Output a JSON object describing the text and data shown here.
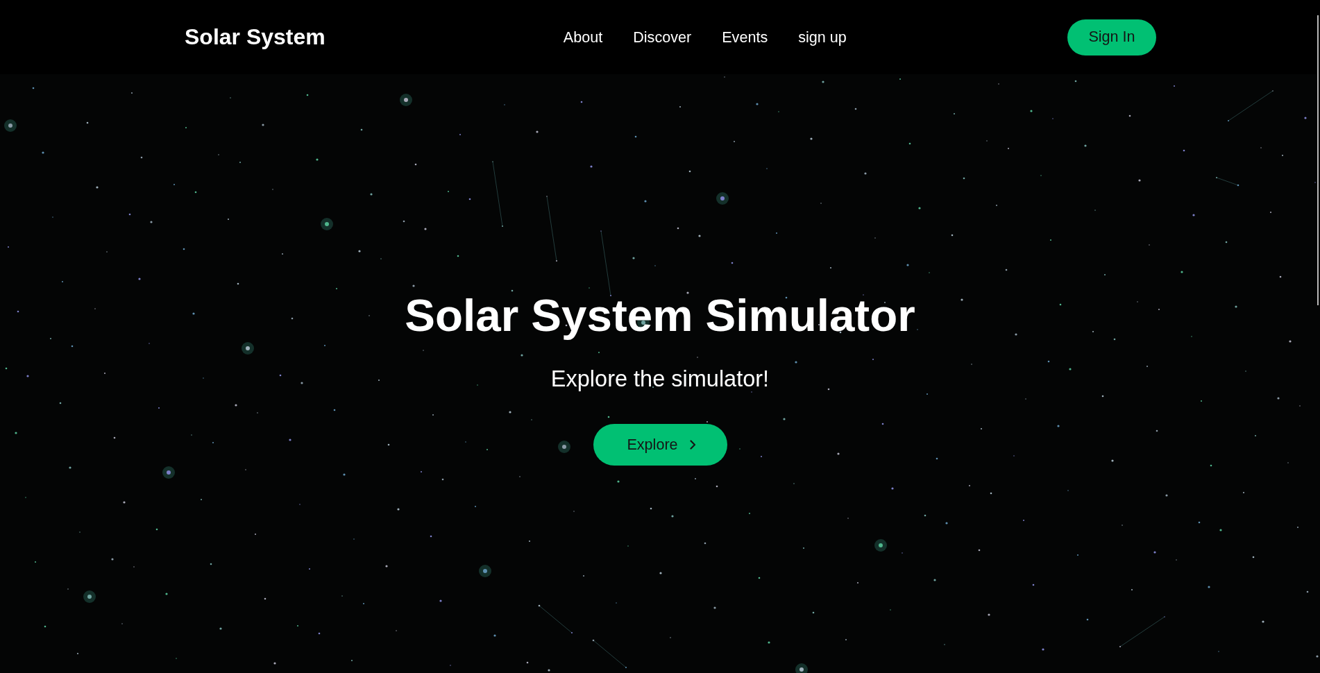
{
  "navbar": {
    "brand": "Solar System",
    "links": [
      "About",
      "Discover",
      "Events",
      "sign up"
    ],
    "sign_in_button": "Sign In"
  },
  "hero": {
    "title": "Solar System Simulator",
    "subtitle": "Explore the simulator!",
    "button": "Explore"
  }
}
